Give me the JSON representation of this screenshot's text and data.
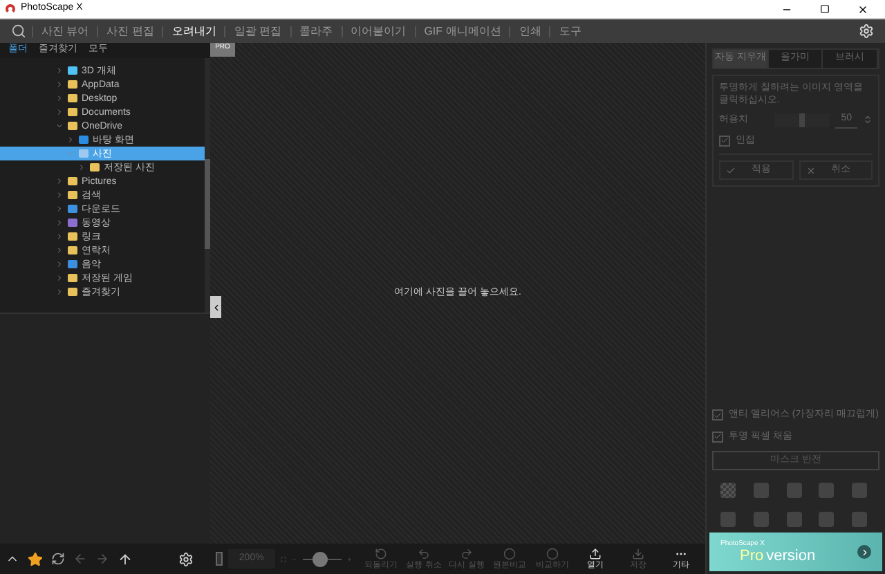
{
  "window": {
    "title": "PhotoScape X"
  },
  "menu": [
    {
      "label": "사진 뷰어",
      "selected": false
    },
    {
      "label": "사진 편집",
      "selected": false
    },
    {
      "label": "오려내기",
      "selected": true
    },
    {
      "label": "일괄 편집",
      "selected": false
    },
    {
      "label": "콜라주",
      "selected": false
    },
    {
      "label": "이어붙이기",
      "selected": false
    },
    {
      "label": "GIF 애니메이션",
      "selected": false
    },
    {
      "label": "인쇄",
      "selected": false
    },
    {
      "label": "도구",
      "selected": false
    }
  ],
  "left_tabs": [
    {
      "label": "폴더",
      "selected": true
    },
    {
      "label": "즐겨찾기",
      "selected": false
    },
    {
      "label": "모두",
      "selected": false
    }
  ],
  "tree": [
    {
      "label": "3D 개체",
      "kind": "object3d",
      "expanded": false,
      "selected": false
    },
    {
      "label": "AppData",
      "kind": "folder",
      "expanded": false,
      "selected": false
    },
    {
      "label": "Desktop",
      "kind": "folder",
      "expanded": false,
      "selected": false
    },
    {
      "label": "Documents",
      "kind": "folder",
      "expanded": false,
      "selected": false
    },
    {
      "label": "OneDrive",
      "kind": "folder",
      "expanded": true,
      "selected": false,
      "children": [
        {
          "label": "바탕 화면",
          "kind": "desktop",
          "expanded": false,
          "selected": false
        },
        {
          "label": "사진",
          "kind": "pictures",
          "expanded": true,
          "selected": true,
          "children": [
            {
              "label": "저장된 사진",
              "kind": "folder",
              "expanded": false,
              "selected": false
            }
          ]
        }
      ]
    },
    {
      "label": "Pictures",
      "kind": "folder",
      "expanded": false,
      "selected": false
    },
    {
      "label": "검색",
      "kind": "search",
      "expanded": false,
      "selected": false
    },
    {
      "label": "다운로드",
      "kind": "download",
      "expanded": false,
      "selected": false
    },
    {
      "label": "동영상",
      "kind": "video",
      "expanded": false,
      "selected": false
    },
    {
      "label": "링크",
      "kind": "link",
      "expanded": false,
      "selected": false
    },
    {
      "label": "연락처",
      "kind": "contact",
      "expanded": false,
      "selected": false
    },
    {
      "label": "음악",
      "kind": "music",
      "expanded": false,
      "selected": false
    },
    {
      "label": "저장된 게임",
      "kind": "game",
      "expanded": false,
      "selected": false
    },
    {
      "label": "즐겨찾기",
      "kind": "star",
      "expanded": false,
      "selected": false
    }
  ],
  "canvas": {
    "badge": "PRO",
    "hint": "여기에 사진을 끌어 놓으세요.",
    "zoom": "200%",
    "zoom_slider": {
      "level": 0.45
    }
  },
  "right_panel": {
    "tabs": [
      {
        "label": "자동 지우개",
        "selected": true
      },
      {
        "label": "올가미",
        "selected": false
      },
      {
        "label": "브러시",
        "selected": false
      }
    ],
    "instruction": "투명하게 칠하려는 이미지 영역을 클릭하십시오.",
    "tolerance": {
      "label": "허용치",
      "level": 0.5,
      "value": "50"
    },
    "contiguous": {
      "label": "인접",
      "checked": true
    },
    "apply": "적용",
    "cancel": "취소",
    "antialias": {
      "label": "앤티 앨리어스 (가장자리 매끄럽게)",
      "checked": true
    },
    "fill_transparent": {
      "label": "투명 픽셀 채움",
      "checked": true
    },
    "invert_mask": "마스크 반전",
    "backgrounds": [
      {
        "kind": "checker"
      },
      {
        "kind": "swatch"
      },
      {
        "kind": "swatch"
      },
      {
        "kind": "swatch"
      },
      {
        "kind": "swatch"
      },
      {
        "kind": "swatch"
      },
      {
        "kind": "swatch"
      },
      {
        "kind": "swatch"
      },
      {
        "kind": "swatch"
      },
      {
        "kind": "swatch"
      }
    ],
    "pro_banner": {
      "brand": "PhotoScape X",
      "pro": "Pro",
      "version": "version"
    }
  },
  "bottom_actions": [
    {
      "label": "되돌리기",
      "kind": "revert"
    },
    {
      "label": "실행 취소",
      "kind": "undo"
    },
    {
      "label": "다시 실행",
      "kind": "redo"
    },
    {
      "label": "원본비교",
      "kind": "compare"
    },
    {
      "label": "비교하기",
      "kind": "compare2"
    },
    {
      "label": "열기",
      "kind": "open"
    },
    {
      "label": "저장",
      "kind": "save"
    },
    {
      "label": "기타",
      "kind": "more"
    }
  ]
}
